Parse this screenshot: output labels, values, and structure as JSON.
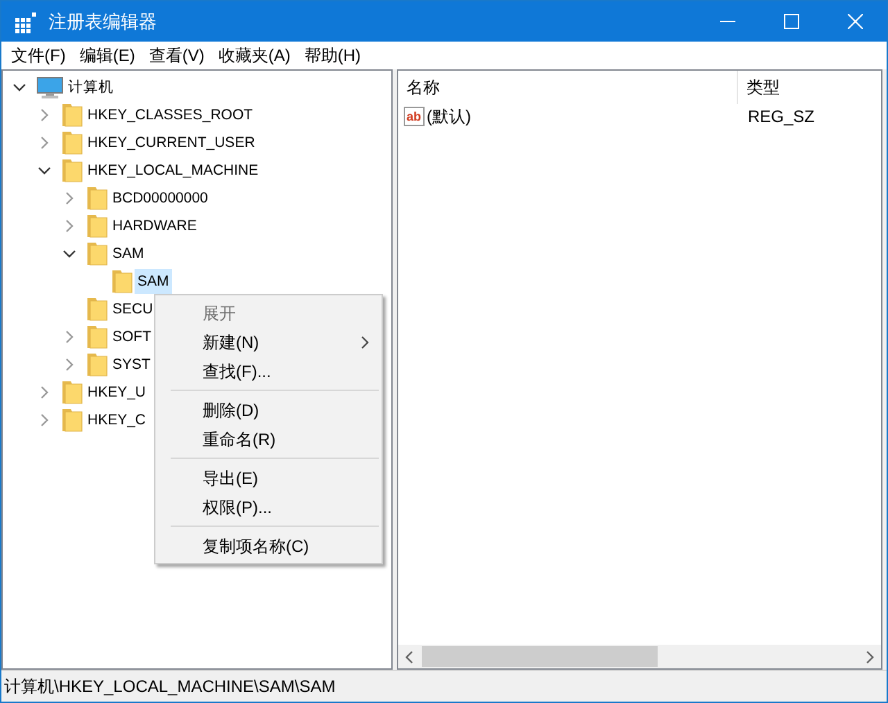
{
  "window": {
    "title": "注册表编辑器"
  },
  "menu_bar": [
    "文件(F)",
    "编辑(E)",
    "查看(V)",
    "收藏夹(A)",
    "帮助(H)"
  ],
  "tree": [
    {
      "label": "计算机",
      "kind": "computer",
      "expanded": true,
      "selected": false,
      "children": [
        {
          "label": "HKEY_CLASSES_ROOT",
          "kind": "folder",
          "expanded": false,
          "selected": false
        },
        {
          "label": "HKEY_CURRENT_USER",
          "kind": "folder",
          "expanded": false,
          "selected": false
        },
        {
          "label": "HKEY_LOCAL_MACHINE",
          "kind": "folder",
          "expanded": true,
          "selected": false,
          "children": [
            {
              "label": "BCD00000000",
              "kind": "folder",
              "expanded": false,
              "selected": false
            },
            {
              "label": "HARDWARE",
              "kind": "folder",
              "expanded": false,
              "selected": false
            },
            {
              "label": "SAM",
              "kind": "folder",
              "expanded": true,
              "selected": false,
              "children": [
                {
                  "label": "SAM",
                  "kind": "folder",
                  "selected": true
                }
              ]
            },
            {
              "label": "SECU",
              "kind": "folder",
              "selected": false
            },
            {
              "label": "SOFT",
              "kind": "folder",
              "expanded": false,
              "selected": false
            },
            {
              "label": "SYST",
              "kind": "folder",
              "expanded": false,
              "selected": false
            }
          ]
        },
        {
          "label": "HKEY_U",
          "kind": "folder",
          "expanded": false,
          "selected": false
        },
        {
          "label": "HKEY_C",
          "kind": "folder",
          "expanded": false,
          "selected": false
        }
      ]
    }
  ],
  "values": {
    "columns": [
      "名称",
      "类型"
    ],
    "rows": [
      {
        "icon_text": "ab",
        "name": "(默认)",
        "type": "REG_SZ"
      }
    ]
  },
  "context_menu": [
    {
      "kind": "item",
      "label": "展开",
      "disabled": true,
      "submenu": false
    },
    {
      "kind": "item",
      "label": "新建(N)",
      "disabled": false,
      "submenu": true
    },
    {
      "kind": "item",
      "label": "查找(F)...",
      "disabled": false,
      "submenu": false
    },
    {
      "kind": "separator"
    },
    {
      "kind": "item",
      "label": "删除(D)",
      "disabled": false,
      "submenu": false
    },
    {
      "kind": "item",
      "label": "重命名(R)",
      "disabled": false,
      "submenu": false
    },
    {
      "kind": "separator"
    },
    {
      "kind": "item",
      "label": "导出(E)",
      "disabled": false,
      "submenu": false
    },
    {
      "kind": "item",
      "label": "权限(P)...",
      "disabled": false,
      "submenu": false
    },
    {
      "kind": "separator"
    },
    {
      "kind": "item",
      "label": "复制项名称(C)",
      "disabled": false,
      "submenu": false
    }
  ],
  "status_bar": "计算机\\HKEY_LOCAL_MACHINE\\SAM\\SAM"
}
